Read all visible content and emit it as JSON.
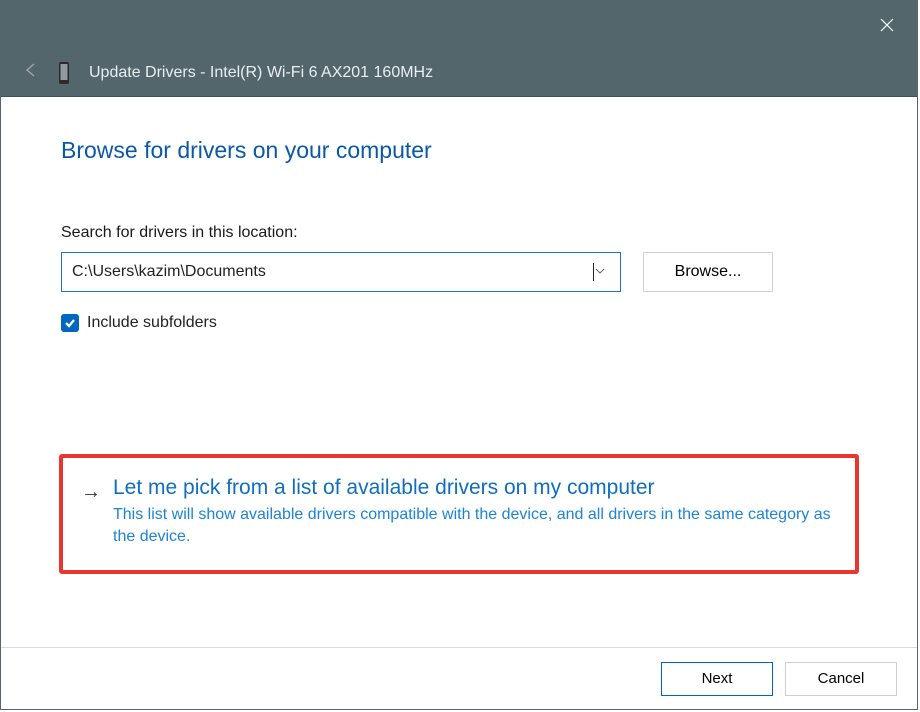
{
  "titlebar": {
    "close_icon": "close"
  },
  "subheader": {
    "title": "Update Drivers - Intel(R) Wi-Fi 6 AX201 160MHz"
  },
  "main": {
    "heading": "Browse for drivers on your computer",
    "search_label": "Search for drivers in this location:",
    "path_value": "C:\\Users\\kazim\\Documents",
    "browse_label": "Browse...",
    "include_subfolders_label": "Include subfolders",
    "include_subfolders_checked": true
  },
  "option": {
    "title": "Let me pick from a list of available drivers on my computer",
    "description": "This list will show available drivers compatible with the device, and all drivers in the same category as the device."
  },
  "footer": {
    "next_label": "Next",
    "cancel_label": "Cancel"
  }
}
